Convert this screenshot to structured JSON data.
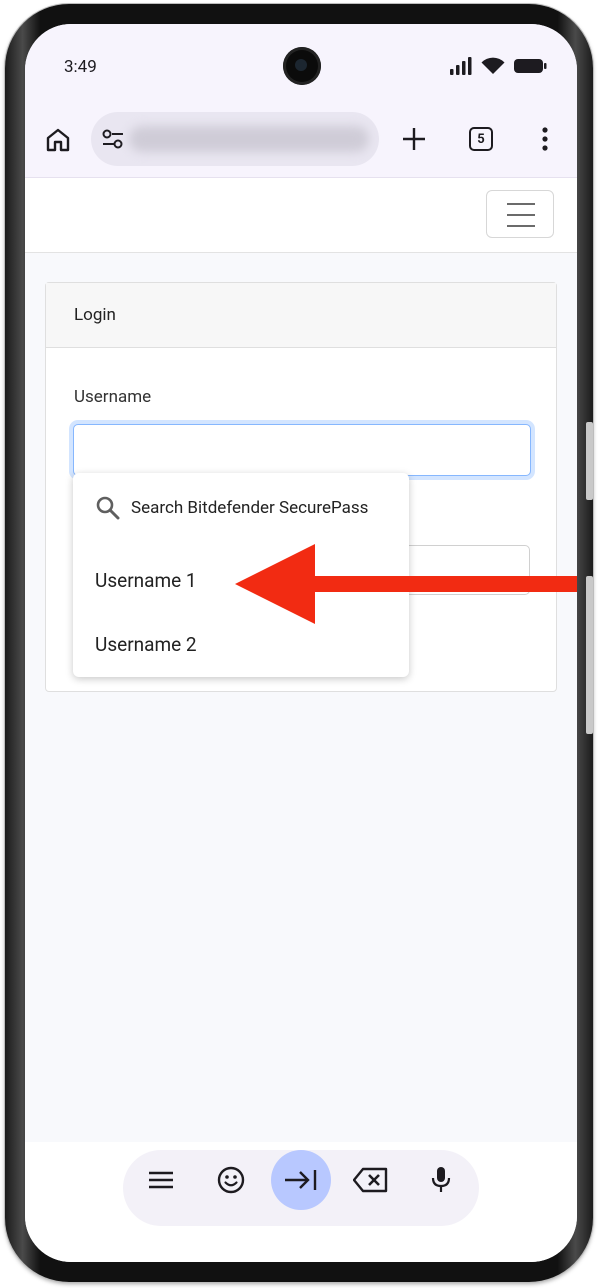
{
  "status_bar": {
    "time": "3:49"
  },
  "browser": {
    "tab_count": "5"
  },
  "page": {
    "card_title": "Login",
    "username_label": "Username"
  },
  "autofill": {
    "search_label": "Search Bitdefender SecurePass",
    "items": [
      "Username 1",
      "Username 2"
    ]
  },
  "colors": {
    "arrow": "#f22b12",
    "focus_border": "#86b7fe",
    "active_key": "#b8c8ff"
  }
}
